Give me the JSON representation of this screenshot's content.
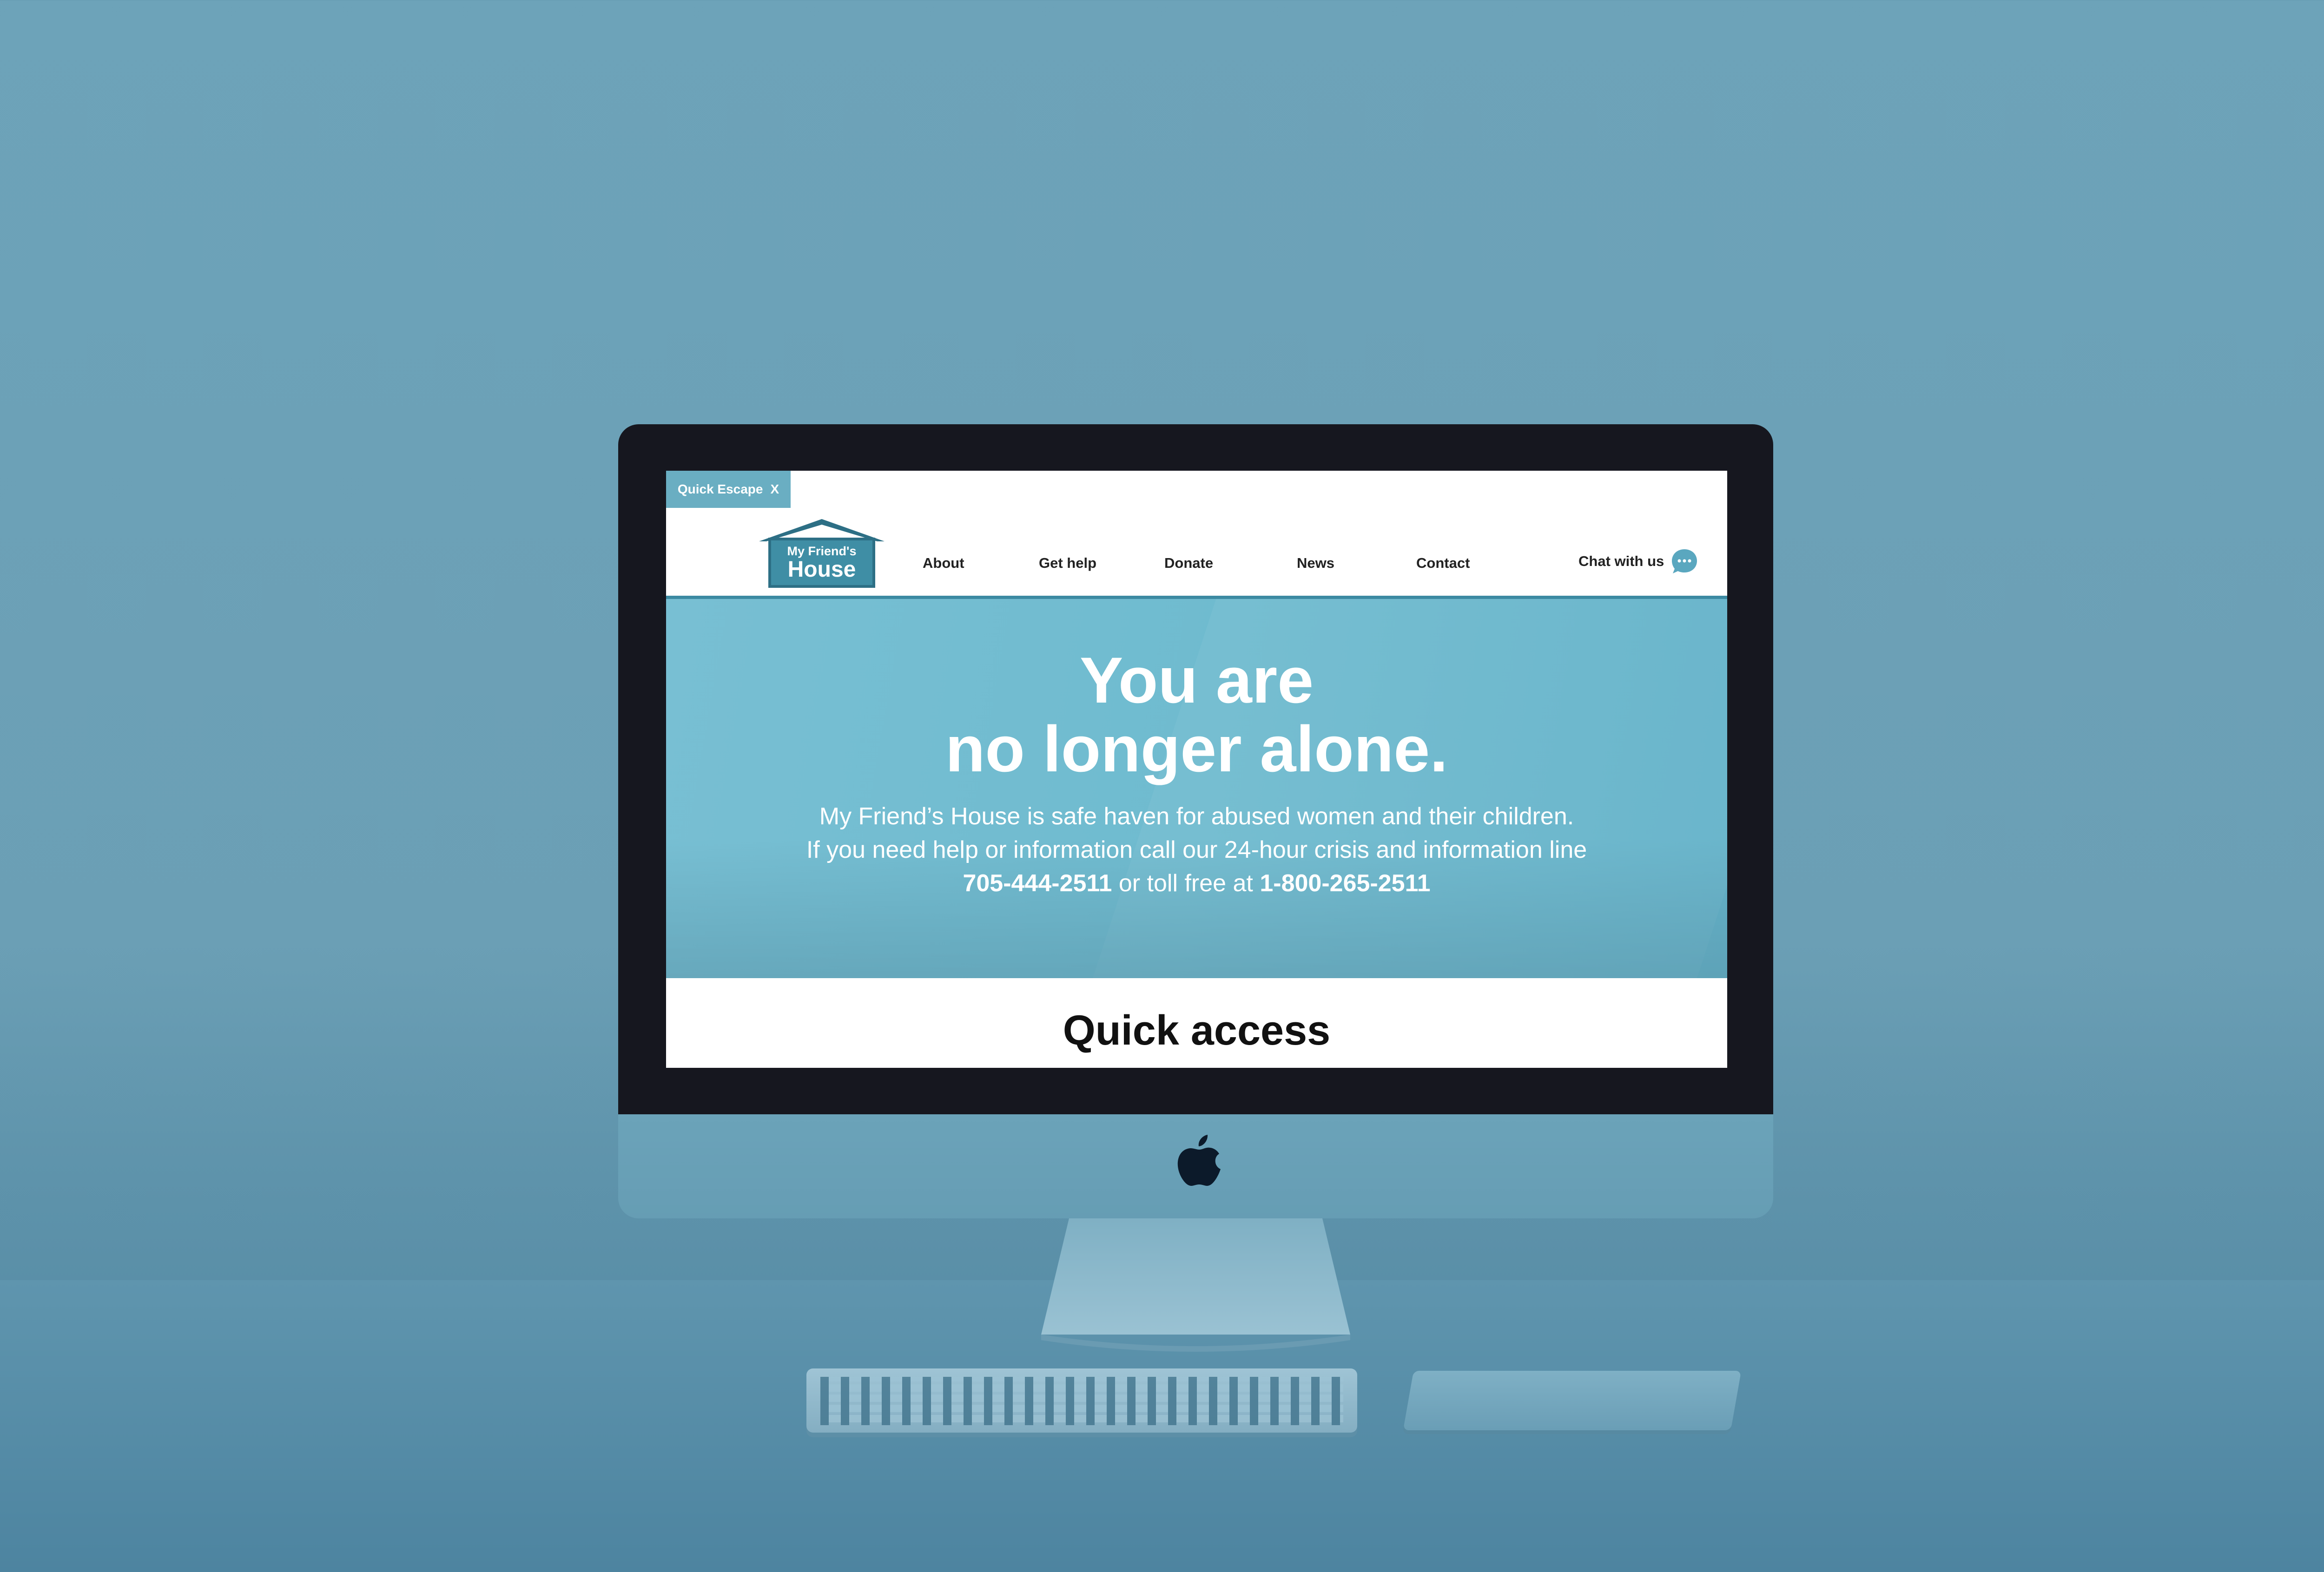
{
  "site": {
    "quick_escape": {
      "label": "Quick Escape",
      "close": "X"
    },
    "logo": {
      "line1": "My Friend's",
      "line2": "House"
    },
    "nav": [
      {
        "label": "About"
      },
      {
        "label": "Get help"
      },
      {
        "label": "Donate"
      },
      {
        "label": "News"
      },
      {
        "label": "Contact"
      }
    ],
    "chat": {
      "label": "Chat with us",
      "icon": "chat-bubble-icon"
    },
    "hero": {
      "headline_line1": "You are",
      "headline_line2": "no longer alone.",
      "body_line1": "My Friend’s House is safe haven for abused women and their children.",
      "body_line2": "If you need help or information call our 24-hour crisis and information line",
      "phone_local": "705-444-2511",
      "phone_connector": "or toll free at",
      "phone_tollfree": "1-800-265-2511"
    },
    "section_title": "Quick access"
  },
  "colors": {
    "background": "#6da3b9",
    "brand_teal": "#3f8ea5",
    "hero": "#6fbbcf",
    "bezel": "#16171f"
  },
  "device": {
    "logo_icon": "apple-logo-icon"
  }
}
